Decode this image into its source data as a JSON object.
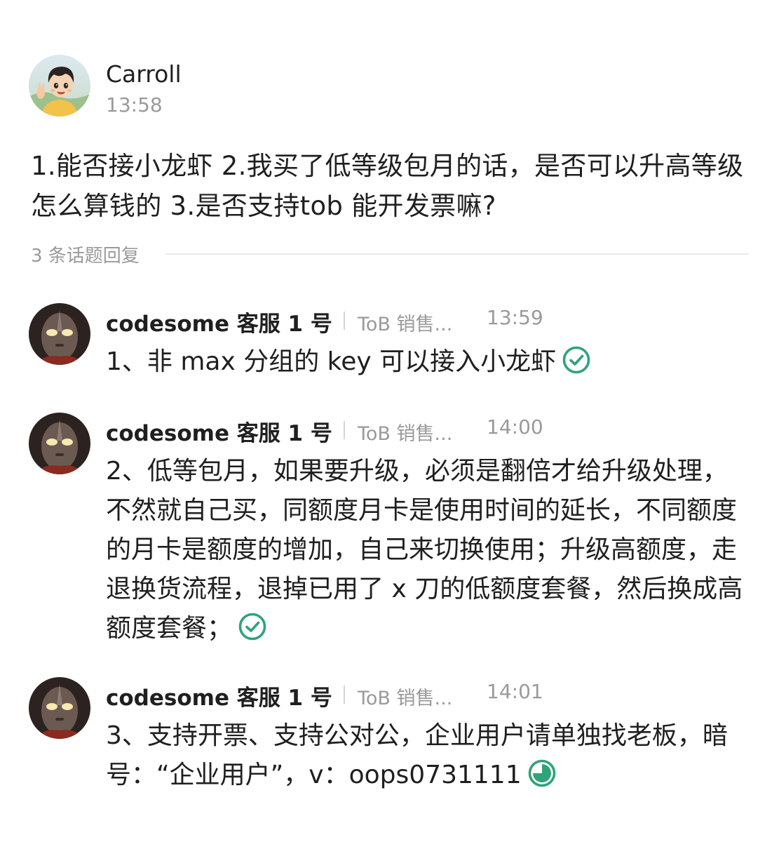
{
  "post": {
    "author": "Carroll",
    "time": "13:58",
    "content": "1.能否接小龙虾  2.我买了低等级包月的话，是否可以升高等级 怎么算钱的 3.是否支持tob  能开发票嘛?",
    "avatar_icon": "cartoon-boy-avatar"
  },
  "thread": {
    "reply_count_label": "3 条话题回复"
  },
  "replies": [
    {
      "author": "codesome 客服 1 号",
      "role": "ToB 销售...",
      "time": "13:59",
      "text": "1、非 max 分组的 key 可以接入小龙虾",
      "status": "read",
      "status_icon": "check-circle-icon"
    },
    {
      "author": "codesome 客服 1 号",
      "role": "ToB 销售...",
      "time": "14:00",
      "text": "2、低等包月，如果要升级，必须是翻倍才给升级处理，不然就自己买，同额度月卡是使用时间的延长，不同额度的月卡是额度的增加，自己来切换使用；升级高额度，走退换货流程，退掉已用了 x 刀的低额度套餐，然后换成高额度套餐；",
      "status": "read",
      "status_icon": "check-circle-icon"
    },
    {
      "author": "codesome 客服 1 号",
      "role": "ToB 销售...",
      "time": "14:01",
      "text": "3、支持开票、支持公对公，企业用户请单独找老板，暗号：“企业用户”，v：oops0731111",
      "status": "partially-read",
      "status_icon": "progress-circle-icon"
    }
  ],
  "colors": {
    "accent_green": "#2fa37a",
    "text_primary": "#1f1f1f",
    "text_secondary": "#9a9a9a",
    "divider": "#e8e8e8"
  }
}
